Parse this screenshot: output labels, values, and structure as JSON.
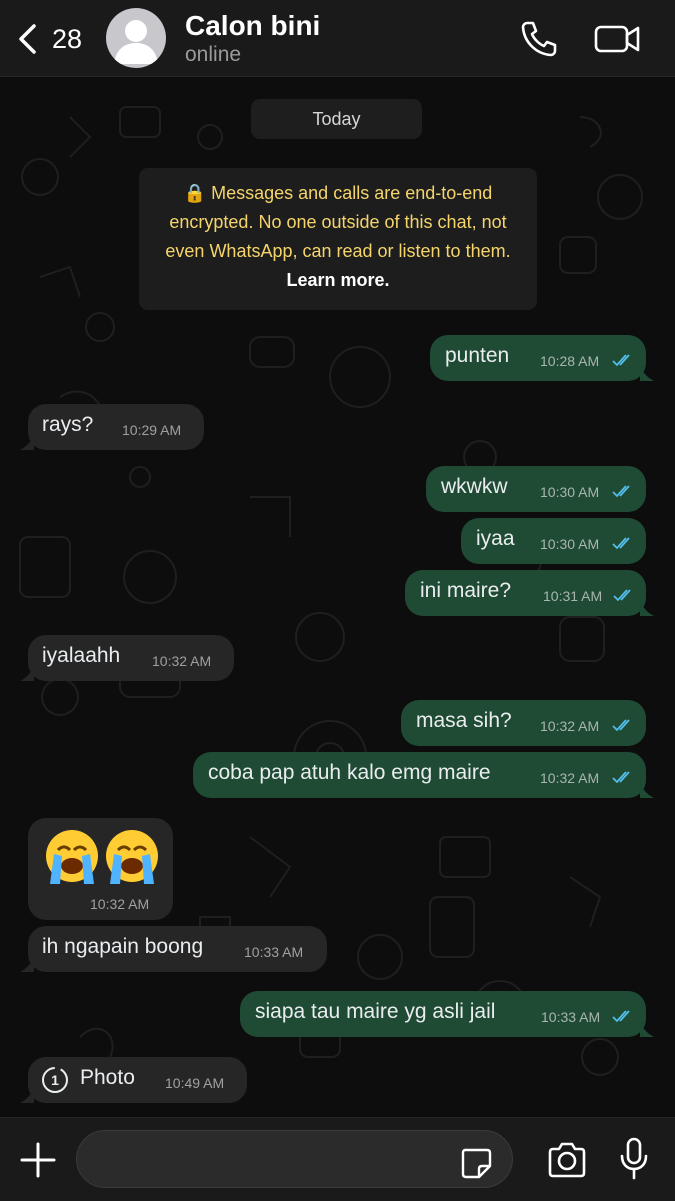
{
  "header": {
    "back_count": "28",
    "contact_name": "Calon bini",
    "status": "online"
  },
  "chat": {
    "date_label": "Today",
    "encryption_notice": "Messages and calls are end-to-end encrypted. No one outside of this chat, not even WhatsApp, can read or listen to them.",
    "learn_more": "Learn more.",
    "messages": [
      {
        "direction": "out",
        "text": "punten",
        "time": "10:28 AM",
        "status": "read"
      },
      {
        "direction": "in",
        "text": "rays?",
        "time": "10:29 AM"
      },
      {
        "direction": "out",
        "text": "wkwkw",
        "time": "10:30 AM",
        "status": "read"
      },
      {
        "direction": "out",
        "text": "iyaa",
        "time": "10:30 AM",
        "status": "read"
      },
      {
        "direction": "out",
        "text": "ini maire?",
        "time": "10:31 AM",
        "status": "read"
      },
      {
        "direction": "in",
        "text": "iyalaahh",
        "time": "10:32 AM"
      },
      {
        "direction": "out",
        "text": "masa sih?",
        "time": "10:32 AM",
        "status": "read"
      },
      {
        "direction": "out",
        "text": "coba pap atuh kalo emg maire",
        "time": "10:32 AM",
        "status": "read"
      },
      {
        "direction": "in",
        "emoji": "loudly-crying-face x2",
        "time": "10:32 AM"
      },
      {
        "direction": "in",
        "text": "ih ngapain boong",
        "time": "10:33 AM"
      },
      {
        "direction": "out",
        "text": "siapa tau maire yg asli jail",
        "time": "10:33 AM",
        "status": "read"
      },
      {
        "direction": "in",
        "text": "Photo",
        "time": "10:49 AM",
        "icon": "view-once-icon"
      }
    ]
  },
  "composer": {
    "placeholder": ""
  },
  "icons": {
    "back": "chevron-left-icon",
    "call": "phone-icon",
    "video": "video-camera-icon",
    "attach": "plus-icon",
    "sticker": "sticker-icon",
    "camera": "camera-icon",
    "mic": "microphone-icon",
    "read": "double-check-icon"
  },
  "colors": {
    "outgoing_bubble": "#1f4a34",
    "incoming_bubble": "#262626",
    "read_ticks": "#53bdeb",
    "encryption_text": "#f5d56b"
  }
}
